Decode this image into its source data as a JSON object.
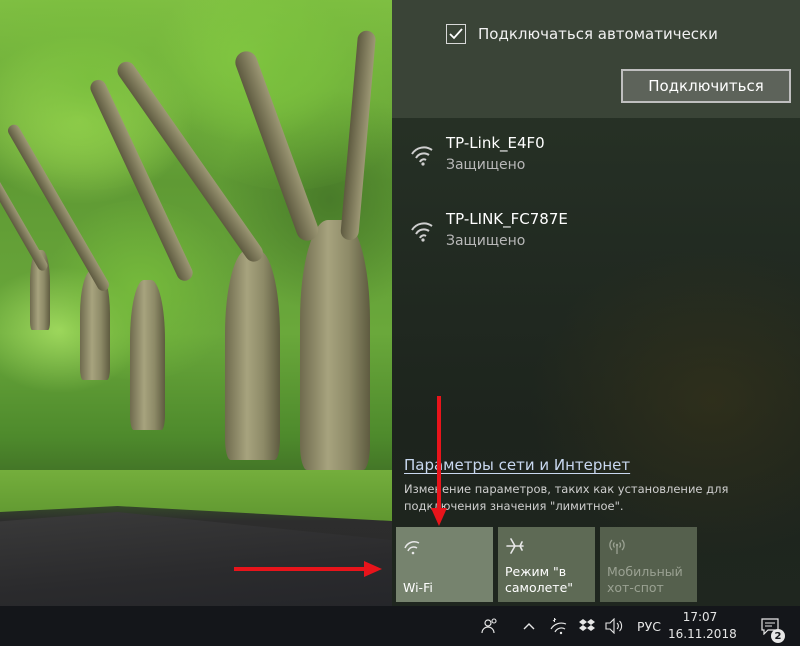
{
  "flyout": {
    "auto_connect_label": "Подключаться автоматически",
    "auto_connect_checked": true,
    "connect_button": "Подключиться",
    "networks": [
      {
        "ssid": "TP-Link_E4F0",
        "status": "Защищено"
      },
      {
        "ssid": "TP-LINK_FC787E",
        "status": "Защищено"
      }
    ],
    "settings_link": "Параметры сети и Интернет",
    "settings_desc": "Изменение параметров, таких как установление для подключения значения \"лимитное\".",
    "tiles": {
      "wifi": {
        "label": "Wi-Fi",
        "icon": "wifi-icon",
        "active": true
      },
      "airplane": {
        "label_line1": "Режим \"в",
        "label_line2": "самолете\"",
        "icon": "airplane-icon"
      },
      "hotspot": {
        "label_line1": "Мобильный",
        "label_line2": "хот-спот",
        "icon": "hotspot-icon",
        "disabled": true
      }
    }
  },
  "taskbar": {
    "language": "РУС",
    "time": "17:07",
    "date": "16.11.2018",
    "notification_count": "2",
    "icons": [
      "people-icon",
      "chevron-up-icon",
      "wifi-icon",
      "dropbox-icon",
      "volume-icon",
      "action-center-icon"
    ]
  },
  "annotations": {
    "arrow_color": "#e8141b"
  },
  "colors": {
    "tile_active": "#76836e",
    "link": "#c9d8f0"
  }
}
